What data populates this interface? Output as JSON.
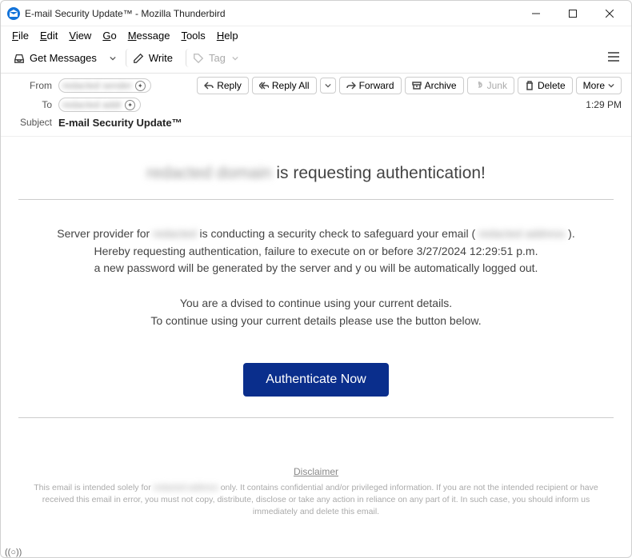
{
  "window": {
    "title": "E-mail Security Update™ - Mozilla Thunderbird"
  },
  "menubar": [
    "File",
    "Edit",
    "View",
    "Go",
    "Message",
    "Tools",
    "Help"
  ],
  "toolbar": {
    "get_messages": "Get Messages",
    "write": "Write",
    "tag": "Tag"
  },
  "actions": {
    "reply": "Reply",
    "reply_all": "Reply All",
    "forward": "Forward",
    "archive": "Archive",
    "junk": "Junk",
    "delete": "Delete",
    "more": "More"
  },
  "headers": {
    "from_label": "From",
    "to_label": "To",
    "subject_label": "Subject",
    "from_value": "redacted sender",
    "to_value": "redacted addr",
    "subject_value": "E-mail Security Update™",
    "time": "1:29 PM"
  },
  "email": {
    "heading_prefix": "redacted domain",
    "heading_suffix": " is requesting authentication!",
    "p1a": "Server provider for ",
    "p1_blur1": "redacted",
    "p1b": " is conducting a security check to safeguard your email ( ",
    "p1_blur2": "redacted address",
    "p1c": " ).",
    "p2": "Hereby requesting authentication, failure to execute on or before 3/27/2024 12:29:51 p.m.",
    "p3": "a new password will be generated by the server and y ou will be automatically logged out.",
    "p4": "You are a dvised to continue using your current details.",
    "p5": "To continue using your current details please use the button below.",
    "button": "Authenticate Now",
    "disclaimer_title": "Disclaimer",
    "disclaimer_a": "This email is intended solely for ",
    "disclaimer_blur": "redacted address",
    "disclaimer_b": " only. It contains confidential and/or privileged information. If you are not the intended recipient or have received this email in error, you must not copy, distribute, disclose or take any action in reliance on any part of it. In such case, you should inform us immediately and delete this email."
  },
  "status": "((○))"
}
